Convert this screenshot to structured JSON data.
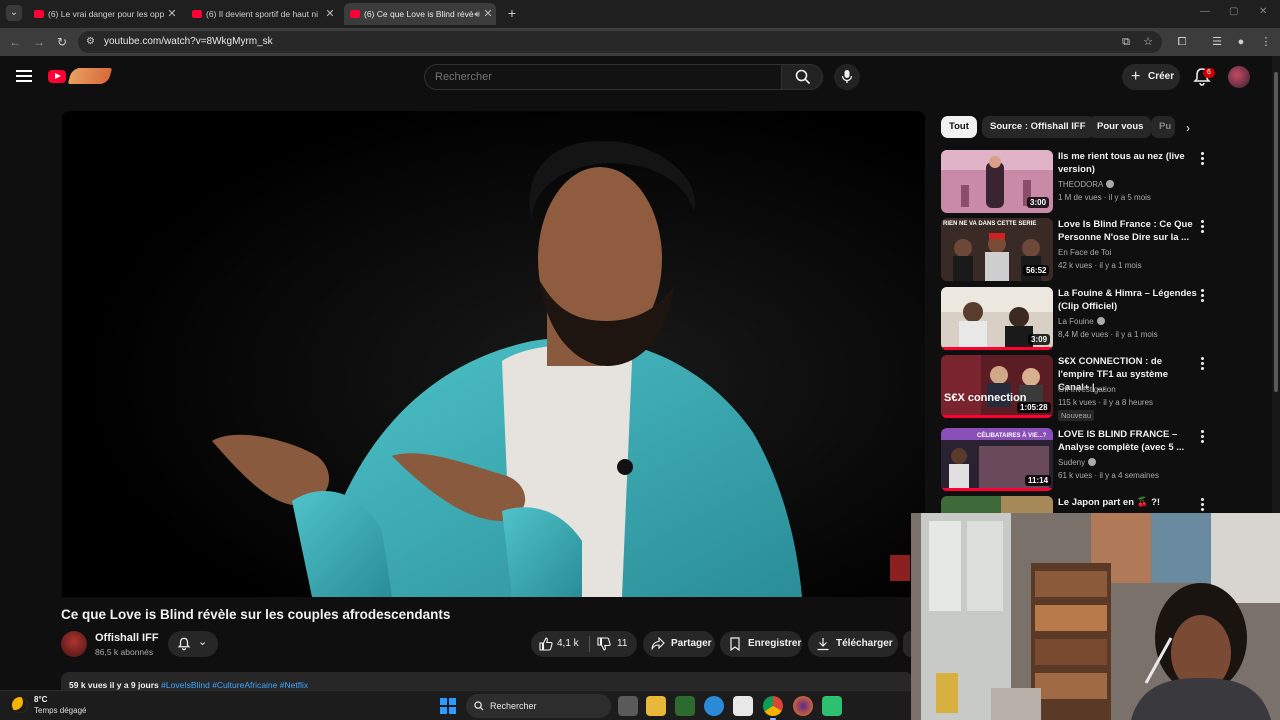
{
  "browser": {
    "tabs": [
      {
        "title": "(6) Le vrai danger pour les opp",
        "active": false
      },
      {
        "title": "(6) Il devient sportif de haut ni",
        "active": false
      },
      {
        "title": "(6) Ce que Love is Blind révè",
        "active": true
      }
    ],
    "url": "youtube.com/watch?v=8WkgMyrm_sk"
  },
  "header": {
    "search_placeholder": "Rechercher",
    "create_label": "Créer",
    "notification_count": "6"
  },
  "video": {
    "title": "Ce que Love is Blind révèle sur les couples afrodescendants",
    "channel": "Offishall IFF",
    "subscribers": "86,5 k abonnés",
    "likes": "4,1 k",
    "dislikes": "11",
    "share_label": "Partager",
    "save_label": "Enregistrer",
    "download_label": "Télécharger",
    "description_stats": "59 k vues  il y a 9 jours",
    "description_tags": "#LoveIsBlind #CultureAfricaine #Netflix"
  },
  "sidebar": {
    "chips": [
      "Tout",
      "Source : Offishall IFF",
      "Pour vous",
      "Pu"
    ],
    "recommendations": [
      {
        "title": "Ils me rient tous au nez (live version)",
        "channel": "THEODORA",
        "verified": true,
        "views": "1 M de vues",
        "age": "il y a 5 mois",
        "duration": "3:00",
        "badge": ""
      },
      {
        "title": "Love Is Blind France : Ce Que Personne N'ose Dire sur la ...",
        "channel": "En Face de Toi",
        "verified": false,
        "views": "42 k vues",
        "age": "il y a 1 mois",
        "duration": "56:52",
        "badge": "",
        "thumb_text": "RIEN NE VA DANS CETTE SERIE"
      },
      {
        "title": "La Fouine & Himra – Légendes (Clip Officiel)",
        "channel": "La Fouine",
        "verified": true,
        "views": "8,4 M de vues",
        "age": "il y a 1 mois",
        "duration": "3:09",
        "badge": ""
      },
      {
        "title": "S€X CONNECTION : de l'empire TF1 au système Canal+ | ...",
        "channel": "Off Investigation",
        "verified": false,
        "views": "115 k vues",
        "age": "il y a 8 heures",
        "duration": "1:05:28",
        "badge": "Nouveau",
        "thumb_text": "S€X connection"
      },
      {
        "title": "LOVE IS BLIND FRANCE – Analyse complète (avec 5 ...",
        "channel": "Sudeny",
        "verified": true,
        "views": "61 k vues",
        "age": "il y a 4 semaines",
        "duration": "11:14",
        "badge": "",
        "thumb_text": "CÉLIBATAIRES À VIE...?"
      },
      {
        "title": "Le Japon part en 🍒 ?!",
        "channel": "",
        "verified": false,
        "views": "",
        "age": "",
        "duration": "",
        "badge": ""
      }
    ]
  },
  "taskbar": {
    "temperature": "8°C",
    "weather": "Temps dégagé",
    "search_label": "Rechercher"
  },
  "colors": {
    "accent": "#ff0033",
    "background": "#0f0f0f",
    "surface": "#272727",
    "link": "#3ea6ff"
  }
}
